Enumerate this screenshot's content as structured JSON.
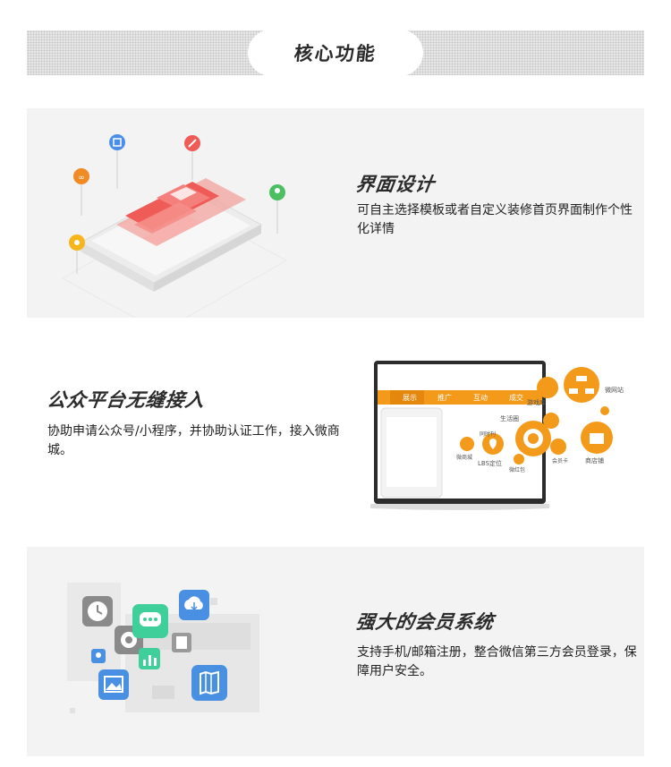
{
  "header": {
    "title": "核心功能"
  },
  "features": [
    {
      "title": "界面设计",
      "description": "可自主选择模板或者自定义装修首页界面制作个性化详情"
    },
    {
      "title": "公众平台无缝接入",
      "description": "协助申请公众号/小程序，并协助认证工作，接入微商城。"
    },
    {
      "title": "强大的会员系统",
      "description": "支持手机/邮箱注册，整合微信第三方会员登录，保障用户安全。"
    }
  ],
  "laptop": {
    "tabs": [
      "展示",
      "推广",
      "互动",
      "成交"
    ],
    "labels": {
      "game": "游戏库",
      "weisite": "微网站",
      "lbs": "LBS定位",
      "circle": "生活圈",
      "shop": "微商城",
      "vip": "会员卡",
      "store": "商店铺",
      "coupon": "同时刊",
      "redpack": "微红包",
      "weshop": "微商场"
    }
  },
  "colors": {
    "accent": "#f39a1b",
    "red": "#ef5b57",
    "panel": "#f3f3f3"
  }
}
